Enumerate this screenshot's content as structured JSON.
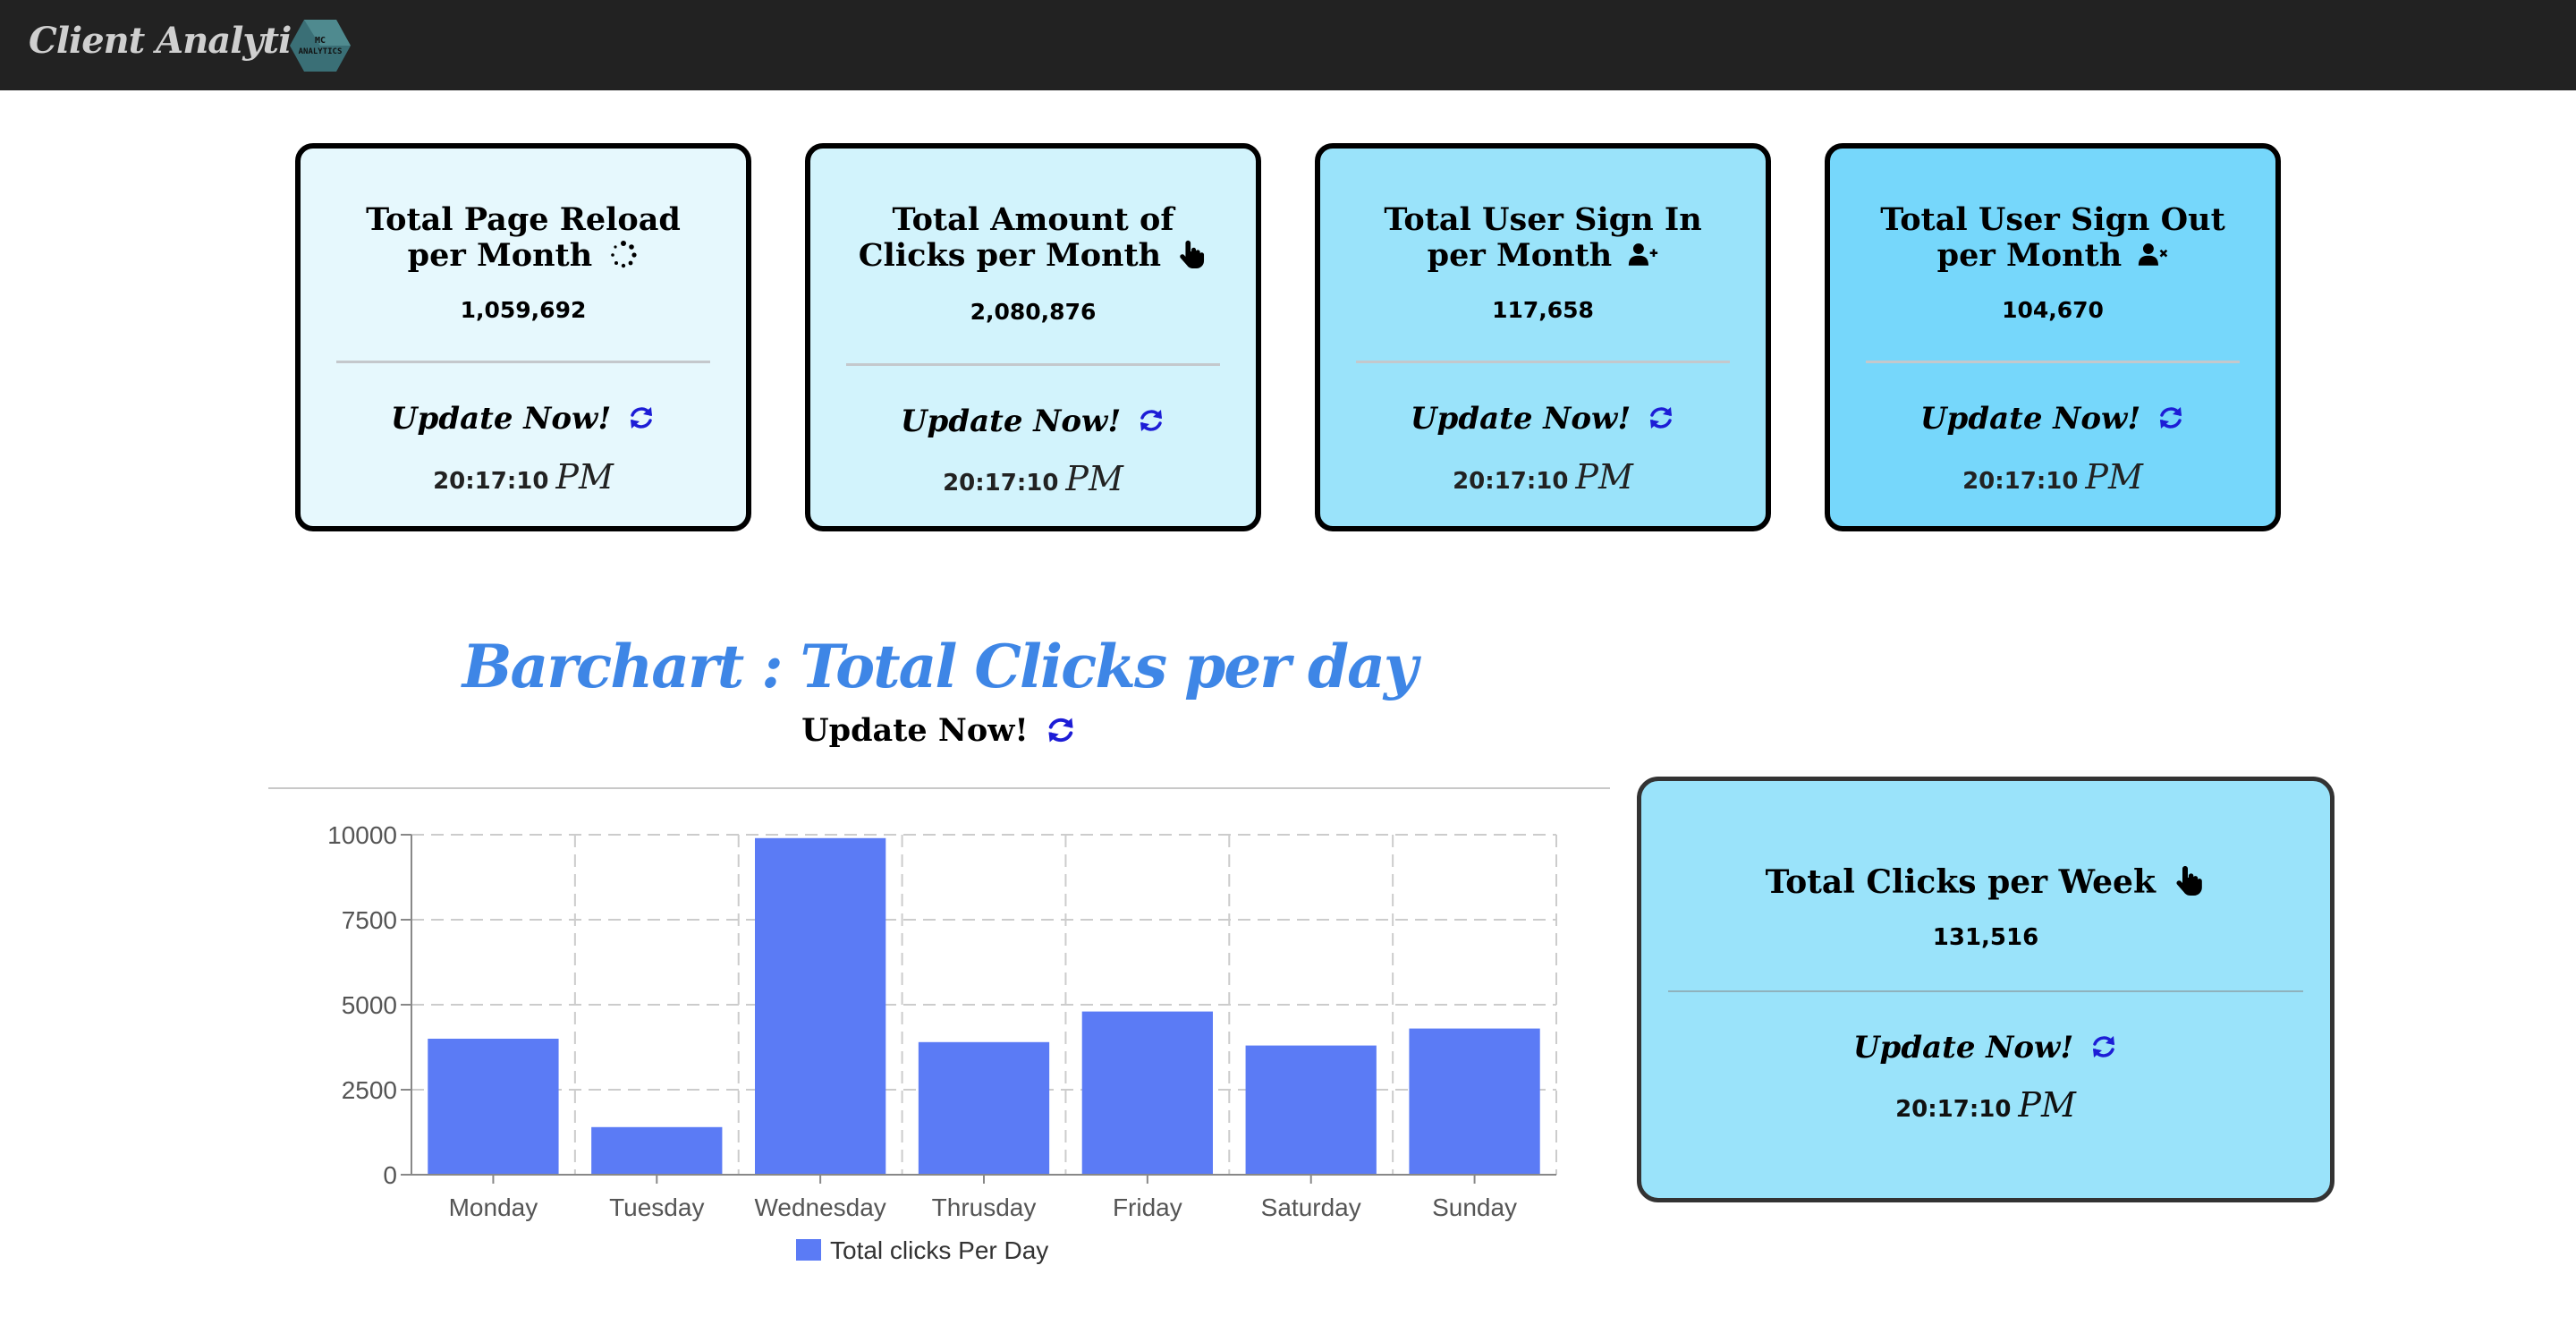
{
  "header": {
    "brand": "Client Analytics",
    "logo_text": "MC ANALYTICS"
  },
  "cards": [
    {
      "title": "Total Page Reload per Month",
      "icon": "spinner-icon",
      "value": "1,059,692",
      "update_label": "Update Now!",
      "time": "20:17:10",
      "ampm": "PM",
      "bg": "#e6f8fd"
    },
    {
      "title": "Total Amount of Clicks per Month",
      "icon": "pointer-hand-icon",
      "value": "2,080,876",
      "update_label": "Update Now!",
      "time": "20:17:10",
      "ampm": "PM",
      "bg": "#d2f3fc"
    },
    {
      "title": "Total User Sign In per Month",
      "icon": "user-plus-icon",
      "value": "117,658",
      "update_label": "Update Now!",
      "time": "20:17:10",
      "ampm": "PM",
      "bg": "#9ae3fa"
    },
    {
      "title": "Total User Sign Out per Month",
      "icon": "user-xmark-icon",
      "value": "104,670",
      "update_label": "Update Now!",
      "time": "20:17:10",
      "ampm": "PM",
      "bg": "#76d7fb"
    }
  ],
  "barchart": {
    "heading": "Barchart : Total Clicks per day",
    "update_label": "Update Now!"
  },
  "chart_data": {
    "type": "bar",
    "categories": [
      "Monday",
      "Tuesday",
      "Wednesday",
      "Thrusday",
      "Friday",
      "Saturday",
      "Sunday"
    ],
    "series": [
      {
        "name": "Total clicks Per Day",
        "values": [
          4000,
          1400,
          9900,
          3900,
          4800,
          3800,
          4300
        ],
        "color": "#5b7bf5"
      }
    ],
    "yticks": [
      "0",
      "2500",
      "5000",
      "7500",
      "10000"
    ],
    "ylim": [
      0,
      10000
    ],
    "grid": true,
    "legend": "bottom"
  },
  "week_card": {
    "title": "Total Clicks per Week",
    "icon": "pointer-hand-icon",
    "value": "131,516",
    "update_label": "Update Now!",
    "time": "20:17:10",
    "ampm": "PM"
  },
  "colors": {
    "header_bg": "#222222",
    "refresh_icon": "#1d1dd6",
    "heading_blue": "#3e86e6",
    "bar": "#5b7bf5"
  }
}
